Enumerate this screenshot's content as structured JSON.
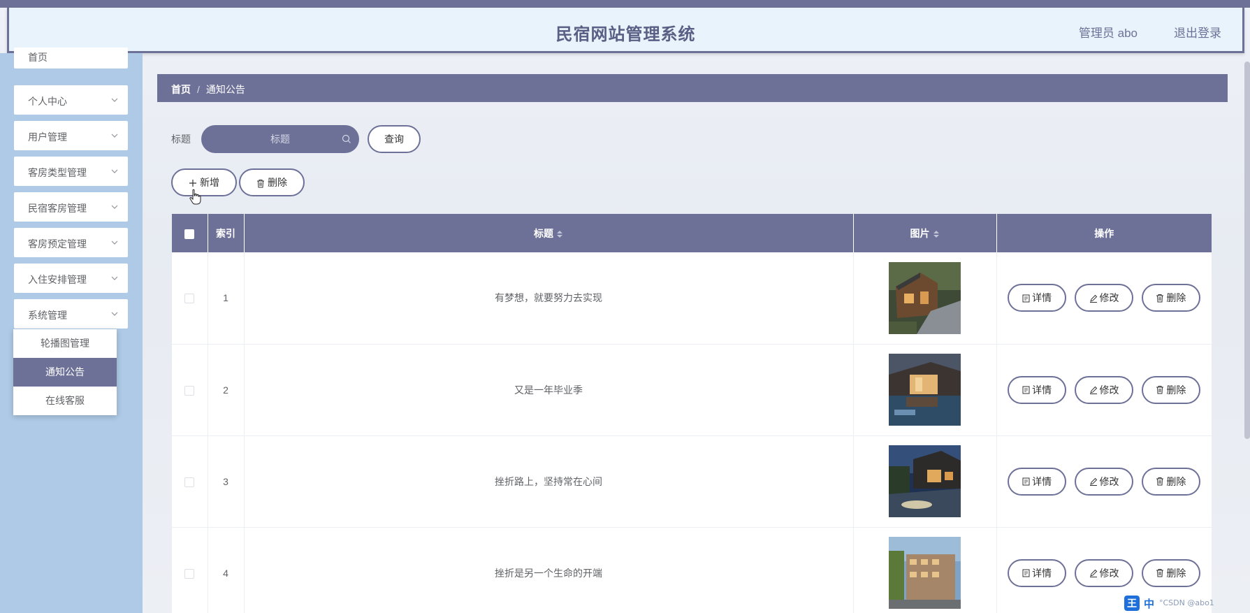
{
  "header": {
    "title": "民宿网站管理系统",
    "admin": "管理员 abo",
    "logout": "退出登录"
  },
  "sidebar": {
    "items": [
      {
        "label": "首页"
      },
      {
        "label": "个人中心"
      },
      {
        "label": "用户管理"
      },
      {
        "label": "客房类型管理"
      },
      {
        "label": "民宿客房管理"
      },
      {
        "label": "客房预定管理"
      },
      {
        "label": "入住安排管理"
      },
      {
        "label": "系统管理"
      }
    ],
    "submenu": [
      {
        "label": "轮播图管理"
      },
      {
        "label": "通知公告"
      },
      {
        "label": "在线客服"
      }
    ]
  },
  "breadcrumb": {
    "home": "首页",
    "current": "通知公告"
  },
  "search": {
    "label": "标题",
    "placeholder": "标题",
    "button": "查询"
  },
  "toolbar": {
    "add": "新增",
    "delete": "删除"
  },
  "table": {
    "headers": {
      "index": "索引",
      "title": "标题",
      "image": "图片",
      "actions": "操作"
    },
    "rows": [
      {
        "index": "1",
        "title": "有梦想，就要努力去实现"
      },
      {
        "index": "2",
        "title": "又是一年毕业季"
      },
      {
        "index": "3",
        "title": "挫折路上，坚持常在心间"
      },
      {
        "index": "4",
        "title": "挫折是另一个生命的开端"
      }
    ],
    "actions": {
      "detail": "详情",
      "edit": "修改",
      "delete": "删除"
    }
  },
  "tray": {
    "ime": "王",
    "lang": "中",
    "watermark": "°CSDN @abo1"
  },
  "colors": {
    "primary": "#6e7197",
    "sidebar": "#aecae6",
    "header_bg": "#e8f3fb"
  }
}
